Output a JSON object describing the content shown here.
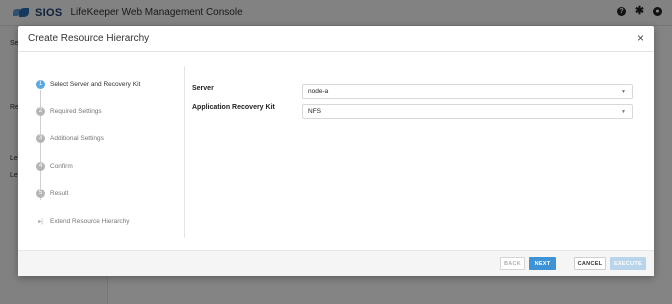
{
  "app": {
    "brand": "SIOS",
    "title": "LifeKeeper Web Management Console",
    "header_icons": [
      "help-icon",
      "gear-icon",
      "user-icon"
    ],
    "sidebar_fragments": [
      "Se",
      "Re",
      "Le",
      "Le"
    ]
  },
  "modal": {
    "title": "Create Resource Hierarchy",
    "close_glyph": "×"
  },
  "steps": [
    {
      "number": "1",
      "label": "Select Server and Recovery Kit",
      "active": true
    },
    {
      "number": "2",
      "label": "Required Settings",
      "active": false
    },
    {
      "number": "3",
      "label": "Additional Settings",
      "active": false
    },
    {
      "number": "4",
      "label": "Confirm",
      "active": false
    },
    {
      "number": "5",
      "label": "Result",
      "active": false
    },
    {
      "number": "",
      "label": "Extend Resource Hierarchy",
      "active": false
    }
  ],
  "form": {
    "server": {
      "label": "Server",
      "value": "node-a"
    },
    "kit": {
      "label": "Application Recovery Kit",
      "value": "NFS"
    }
  },
  "footer": {
    "back": "BACK",
    "next": "NEXT",
    "cancel": "CANCEL",
    "execute": "EXECUTE"
  },
  "colors": {
    "accent": "#3d93d6",
    "step_active": "#5aa9e0",
    "brand": "#1c3f73"
  }
}
